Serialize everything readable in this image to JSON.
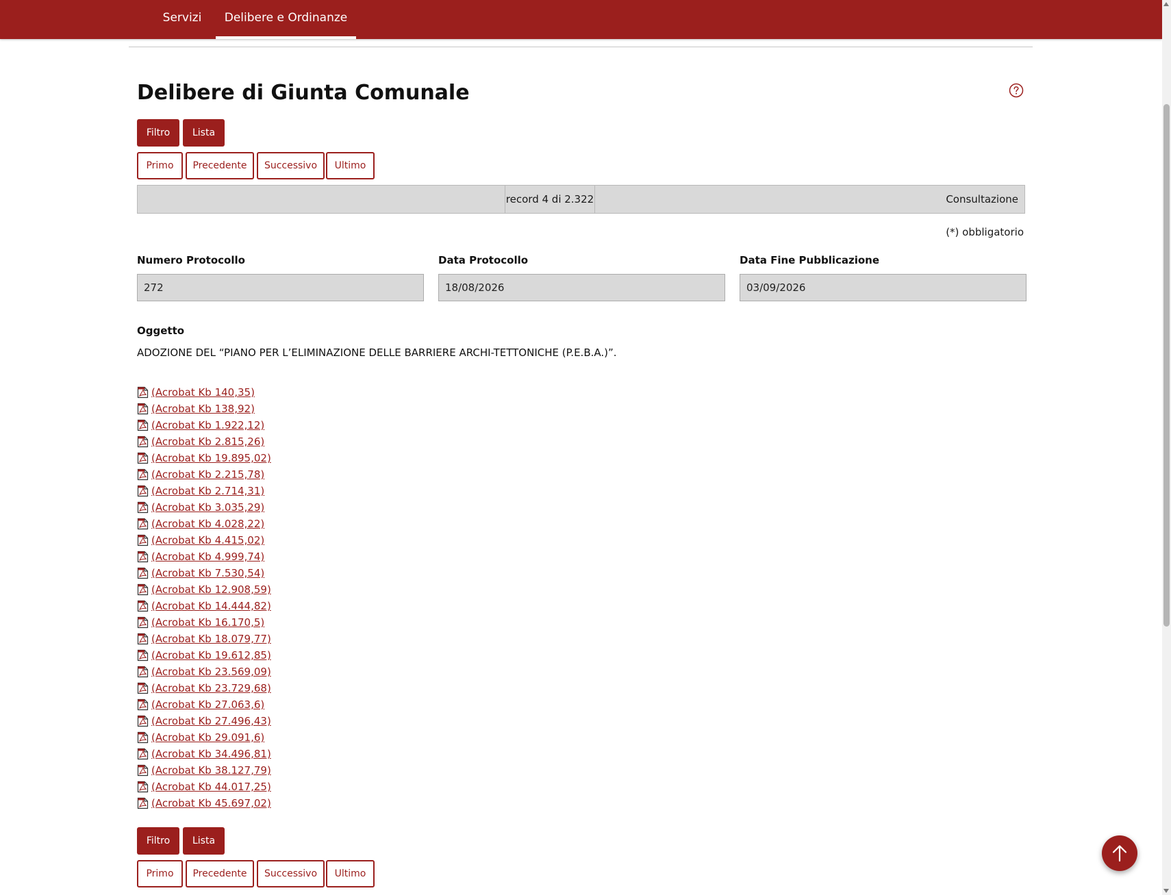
{
  "nav": {
    "tabs": [
      {
        "label": "Servizi",
        "active": false
      },
      {
        "label": "Delibere e Ordinanze",
        "active": true
      }
    ]
  },
  "page": {
    "title": "Delibere di Giunta Comunale"
  },
  "toolbar": {
    "filtro_label": "Filtro",
    "lista_label": "Lista",
    "primo_label": "Primo",
    "precedente_label": "Precedente",
    "successivo_label": "Successivo",
    "ultimo_label": "Ultimo"
  },
  "status": {
    "record_text": "record 4 di 2.322",
    "mode_text": "Consultazione"
  },
  "form": {
    "required_note": "(*) obbligatorio",
    "numero_protocollo": {
      "label": "Numero Protocollo",
      "value": "272"
    },
    "data_protocollo": {
      "label": "Data Protocollo",
      "value": "18/08/2026"
    },
    "data_fine_pubblicazione": {
      "label": "Data Fine Pubblicazione",
      "value": "03/09/2026"
    },
    "oggetto": {
      "label": "Oggetto",
      "value": "ADOZIONE DEL “PIANO PER L’ELIMINAZIONE DELLE BARRIERE ARCHI-TETTONICHE (P.E.B.A.)”."
    }
  },
  "attachments": [
    "(Acrobat Kb 140,35)",
    "(Acrobat Kb 138,92)",
    "(Acrobat Kb 1.922,12)",
    "(Acrobat Kb 2.815,26)",
    "(Acrobat Kb 19.895,02)",
    "(Acrobat Kb 2.215,78)",
    "(Acrobat Kb 2.714,31)",
    "(Acrobat Kb 3.035,29)",
    "(Acrobat Kb 4.028,22)",
    "(Acrobat Kb 4.415,02)",
    "(Acrobat Kb 4.999,74)",
    "(Acrobat Kb 7.530,54)",
    "(Acrobat Kb 12.908,59)",
    "(Acrobat Kb 14.444,82)",
    "(Acrobat Kb 16.170,5)",
    "(Acrobat Kb 18.079,77)",
    "(Acrobat Kb 19.612,85)",
    "(Acrobat Kb 23.569,09)",
    "(Acrobat Kb 23.729,68)",
    "(Acrobat Kb 27.063,6)",
    "(Acrobat Kb 27.496,43)",
    "(Acrobat Kb 29.091,6)",
    "(Acrobat Kb 34.496,81)",
    "(Acrobat Kb 38.127,79)",
    "(Acrobat Kb 44.017,25)",
    "(Acrobat Kb 45.697,02)"
  ],
  "icons": {
    "attachment": "pdf-file-icon",
    "help": "question-circle-icon",
    "back_to_top": "arrow-up-icon"
  },
  "colors": {
    "brand": "#9b1f1d",
    "field_bg": "#d9d9d9"
  }
}
